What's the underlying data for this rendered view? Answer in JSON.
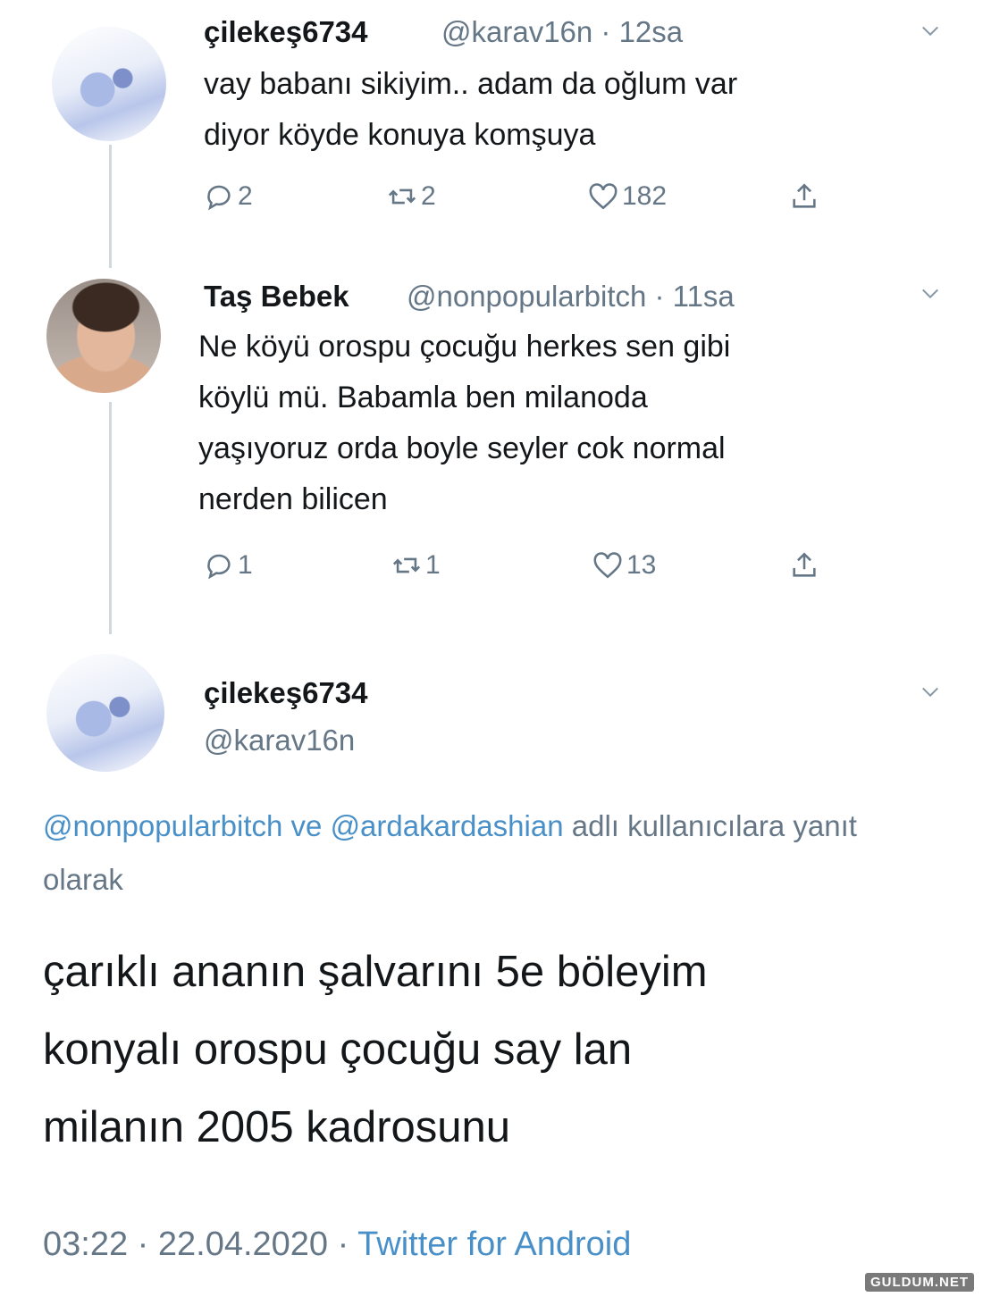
{
  "tweets": [
    {
      "name": "çilekeş6734",
      "handle_time": "@karav16n · 12sa",
      "text": "vay babanı sikiyim.. adam da oğlum var\ndiyor köyde konuya komşuya",
      "replies": "2",
      "retweets": "2",
      "likes": "182"
    },
    {
      "name": "Taş Bebek",
      "handle_time": "@nonpopularbitch · 11sa",
      "text": "Ne köyü orospu çocuğu herkes sen gibi\nköylü mü. Babamla ben milanoda\nyaşıyoruz orda boyle seyler cok normal\nnerden bilicen",
      "replies": "1",
      "retweets": "1",
      "likes": "13"
    }
  ],
  "main_tweet": {
    "name": "çilekeş6734",
    "handle": "@karav16n",
    "reply_mention_1": "@nonpopularbitch",
    "reply_connector": "ve",
    "reply_mention_2": "@ardakardashian",
    "reply_suffix": "adlı kullanıcılara yanıt olarak",
    "text": "çarıklı ananın şalvarını 5e böleyim\nkonyalı orospu çocuğu say lan\nmilanın 2005 kadrosunu",
    "time_date": "03:22 · 22.04.2020 ·",
    "source": "Twitter for Android"
  },
  "watermark": "GULDUM.NET",
  "icons": [
    "reply-icon",
    "retweet-icon",
    "like-icon",
    "share-icon",
    "chevron-down-icon"
  ],
  "colors": {
    "text": "#14171a",
    "secondary": "#657786",
    "link": "#4a90c8",
    "thread_line": "#cfd9de"
  }
}
